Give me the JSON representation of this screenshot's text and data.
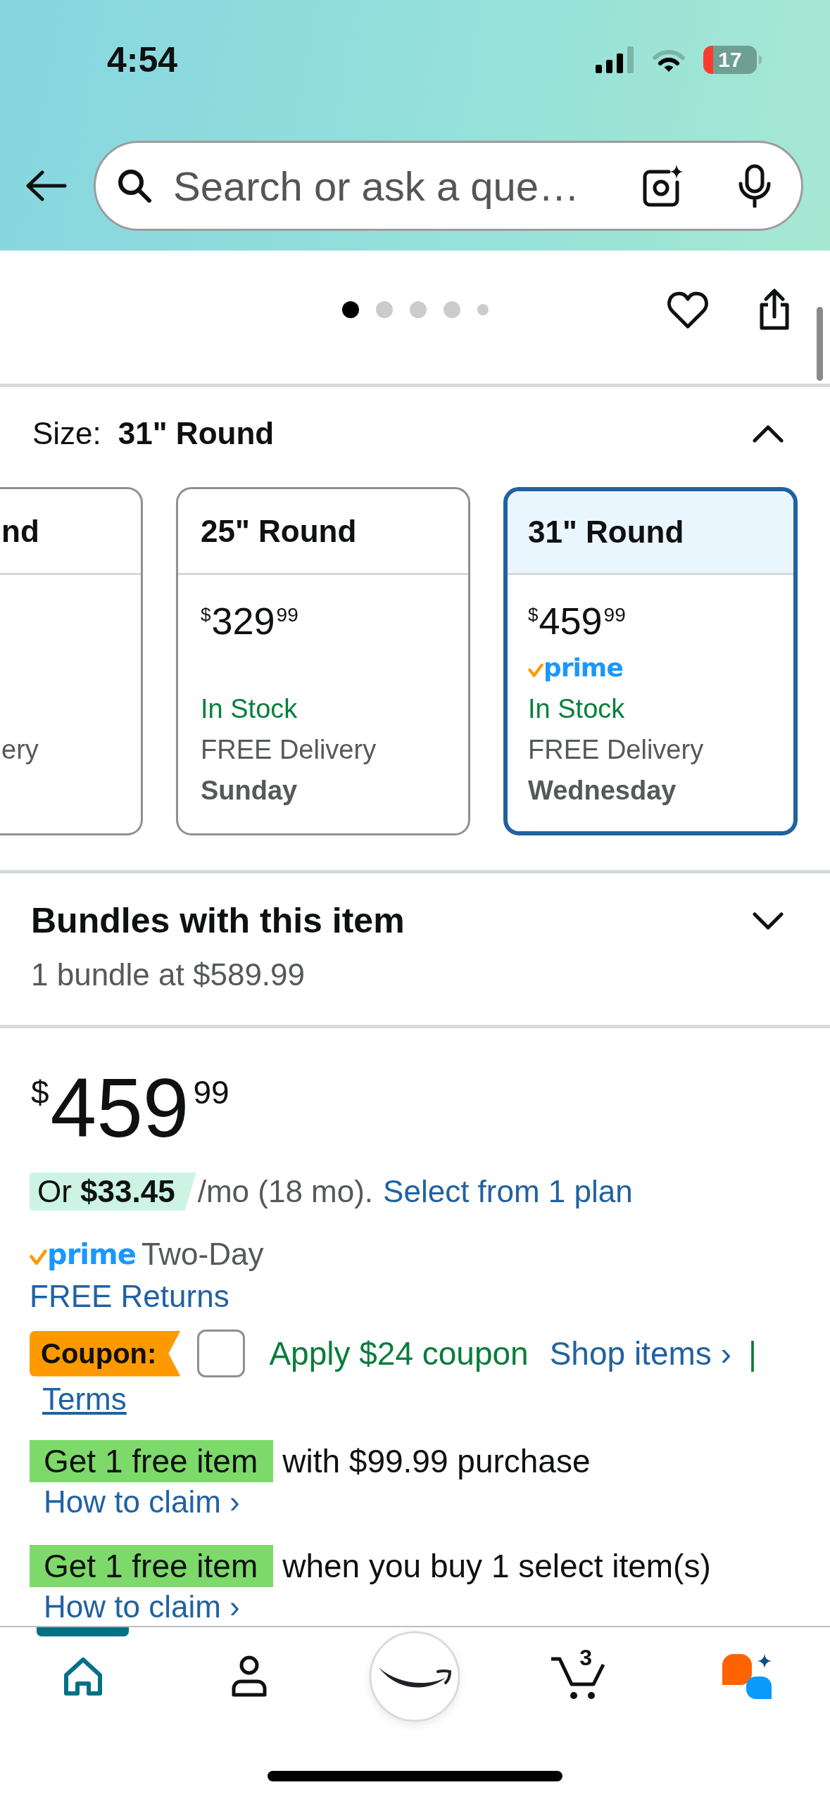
{
  "status_bar": {
    "time": "4:54",
    "battery": "17"
  },
  "header": {
    "search": {
      "placeholder": "Search or ask a que…"
    }
  },
  "gallery": {
    "dots": [
      {
        "kind": "page",
        "selected": true
      },
      {
        "kind": "page",
        "selected": false
      },
      {
        "kind": "page",
        "selected": false
      },
      {
        "kind": "page",
        "selected": false
      },
      {
        "kind": "more",
        "selected": false
      }
    ]
  },
  "size": {
    "label": "Size:",
    "value": "31\" Round",
    "expanded": true,
    "options": [
      {
        "kind": "partial",
        "title": "nd",
        "delivery": "ery",
        "selected": false
      },
      {
        "kind": "full",
        "title": "25\" Round",
        "price": {
          "currency": "$",
          "whole": "329",
          "fraction": "99"
        },
        "stock": "In Stock",
        "delivery": "FREE Delivery",
        "day": "Sunday",
        "selected": false
      },
      {
        "kind": "full",
        "title": "31\" Round",
        "price": {
          "currency": "$",
          "whole": "459",
          "fraction": "99"
        },
        "badge": "prime",
        "stock": "In Stock",
        "delivery": "FREE Delivery",
        "day": "Wednesday",
        "selected": true
      }
    ]
  },
  "bundles": {
    "title": "Bundles with this item",
    "subtitle": "1 bundle at $589.99",
    "expanded": false
  },
  "price": {
    "currency": "$",
    "whole": "459",
    "fraction": "99"
  },
  "financing": {
    "amount": "Or **$33.45**",
    "term": "/mo (18 mo).",
    "link": "Select from 1 plan"
  },
  "shipping": {
    "badge": "prime",
    "text": "Two-Day"
  },
  "returns": {
    "link": "FREE Returns"
  },
  "coupon": {
    "badge": "Coupon:",
    "checked": false,
    "text": "Apply $24 coupon",
    "link": "Shop items ›",
    "separator": "|",
    "terms": "Terms"
  },
  "promotions": [
    {
      "badge": "Get 1 free item",
      "text": "with $99.99 purchase",
      "link": "How to claim ›"
    },
    {
      "badge": "Get 1 free item",
      "text": "when you buy 1 select item(s)",
      "link": "How to claim ›"
    }
  ],
  "nav": [
    {
      "kind": "home",
      "selected": true
    },
    {
      "kind": "account",
      "selected": false
    },
    {
      "kind": "logo",
      "selected": false
    },
    {
      "kind": "cart",
      "selected": false,
      "count": "3"
    },
    {
      "kind": "assistant",
      "selected": false
    }
  ]
}
